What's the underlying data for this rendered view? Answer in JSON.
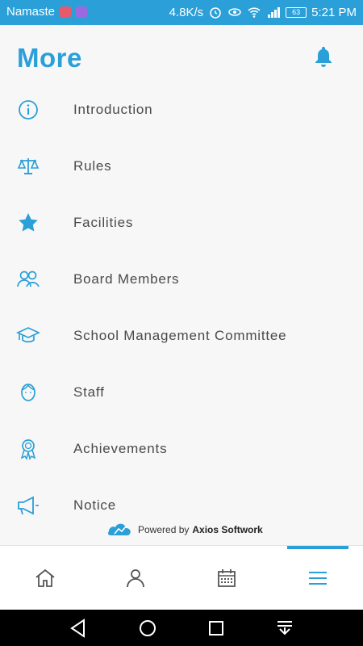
{
  "status_bar": {
    "carrier": "Namaste",
    "speed": "4.8K/s",
    "battery": "63",
    "time": "5:21 PM"
  },
  "header": {
    "title": "More",
    "bell_icon": "bell-icon"
  },
  "menu": [
    {
      "label": "Introduction",
      "icon": "info-icon"
    },
    {
      "label": "Rules",
      "icon": "scales-icon"
    },
    {
      "label": "Facilities",
      "icon": "star-icon"
    },
    {
      "label": "Board Members",
      "icon": "users-icon"
    },
    {
      "label": "School Management Committee",
      "icon": "graduation-cap-icon"
    },
    {
      "label": "Staff",
      "icon": "person-face-icon"
    },
    {
      "label": "Achievements",
      "icon": "award-ribbon-icon"
    },
    {
      "label": "Notice",
      "icon": "megaphone-icon"
    }
  ],
  "footer": {
    "powered_prefix": "Powered by",
    "powered_brand": "Axios Softwork"
  },
  "bottom_nav": {
    "items": [
      "home-icon",
      "profile-icon",
      "calendar-icon",
      "menu-icon"
    ],
    "active_index": 3
  },
  "colors": {
    "accent": "#2a9fd8",
    "text": "#4a4a4a",
    "background": "#f7f7f7"
  }
}
